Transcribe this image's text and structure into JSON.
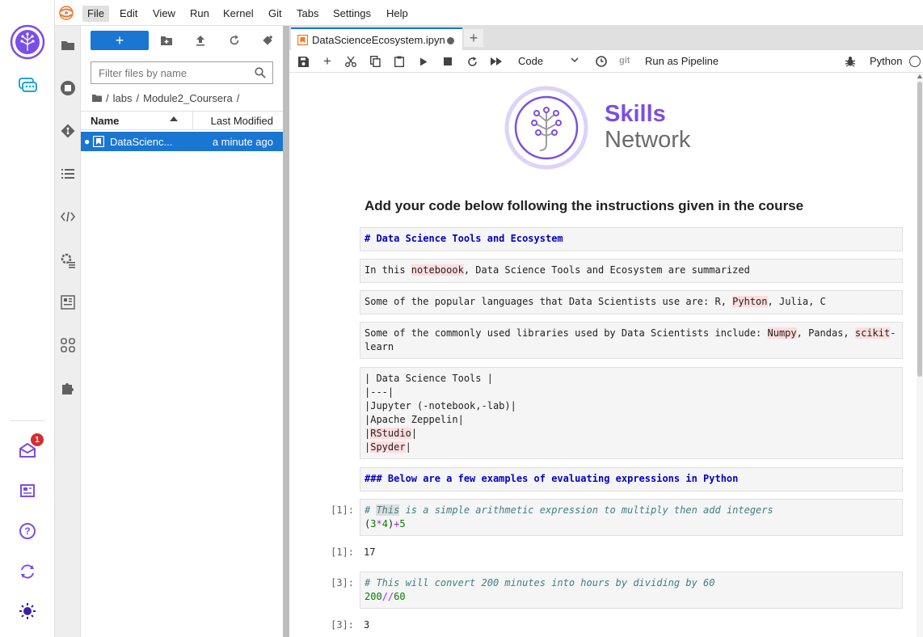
{
  "menubar": {
    "items": [
      "File",
      "Edit",
      "View",
      "Run",
      "Kernel",
      "Git",
      "Tabs",
      "Settings",
      "Help"
    ],
    "active": "File"
  },
  "rail": {
    "notification_count": "1"
  },
  "filebrowser": {
    "filter_placeholder": "Filter files by name",
    "breadcrumbs": [
      "/",
      "labs",
      "/",
      "Module2_Coursera",
      "/"
    ],
    "col_name": "Name",
    "col_modified": "Last Modified",
    "files": [
      {
        "name": "DataScienceEcosystem.ipynb",
        "display_name": "DataScienc...",
        "modified": "a minute ago"
      }
    ]
  },
  "notebook": {
    "tab_title": "DataScienceEcosystem.ipynb",
    "cell_type": "Code",
    "git_label": "git",
    "pipeline_label": "Run as Pipeline",
    "kernel_name": "Python",
    "logo_line1": "Skills",
    "logo_line2": "Network",
    "heading": "Add your code below following the instructions given in the course",
    "cells": {
      "md1": "# Data Science Tools and Ecosystem",
      "md2_a": "In this ",
      "md2_hl": "noteboook",
      "md2_b": ", Data Science Tools and Ecosystem are summarized",
      "md3_a": "Some of the popular languages that Data Scientists use are: R, ",
      "md3_hl": "Pyhton",
      "md3_b": ", Julia, C",
      "md4_a": "Some of the commonly used libraries used by Data Scientists include: ",
      "md4_hl1": "Numpy",
      "md4_b": ", Pandas, ",
      "md4_hl2": "scikit",
      "md4_c": "-\nlearn",
      "md5_l1": "| Data Science Tools |",
      "md5_l2": "|---|",
      "md5_l3": "|Jupyter (-notebook,-lab)|",
      "md5_l4": "|Apache Zeppelin|",
      "md5_l5_a": "|",
      "md5_l5_hl": "RStudio",
      "md5_l5_b": "|",
      "md5_l6_a": "|",
      "md5_l6_hl": "Spyder",
      "md5_l6_b": "|",
      "md6": "### Below are a few examples of evaluating expressions in Python",
      "code1_prompt": "[1]:",
      "code1_c1": "# ",
      "code1_c_sel": "This",
      "code1_c2": " is a simple arithmetic expression to multiply then add integers",
      "code1_l2_p1": "(",
      "code1_l2_n1": "3",
      "code1_l2_op1": "*",
      "code1_l2_n2": "4",
      "code1_l2_p2": ")",
      "code1_l2_op2": "+",
      "code1_l2_n3": "5",
      "out1_prompt": "[1]:",
      "out1": "17",
      "code2_prompt": "[3]:",
      "code2_comment": "# This will convert 200 minutes into hours by dividing by 60",
      "code2_n1": "200",
      "code2_op": "//",
      "code2_n2": "60",
      "out2_prompt": "[3]:",
      "out2": "3"
    }
  },
  "colors": {
    "accent": "#1976d2",
    "brand_purple": "#7b4ee6",
    "md_heading": "#0000cc"
  }
}
